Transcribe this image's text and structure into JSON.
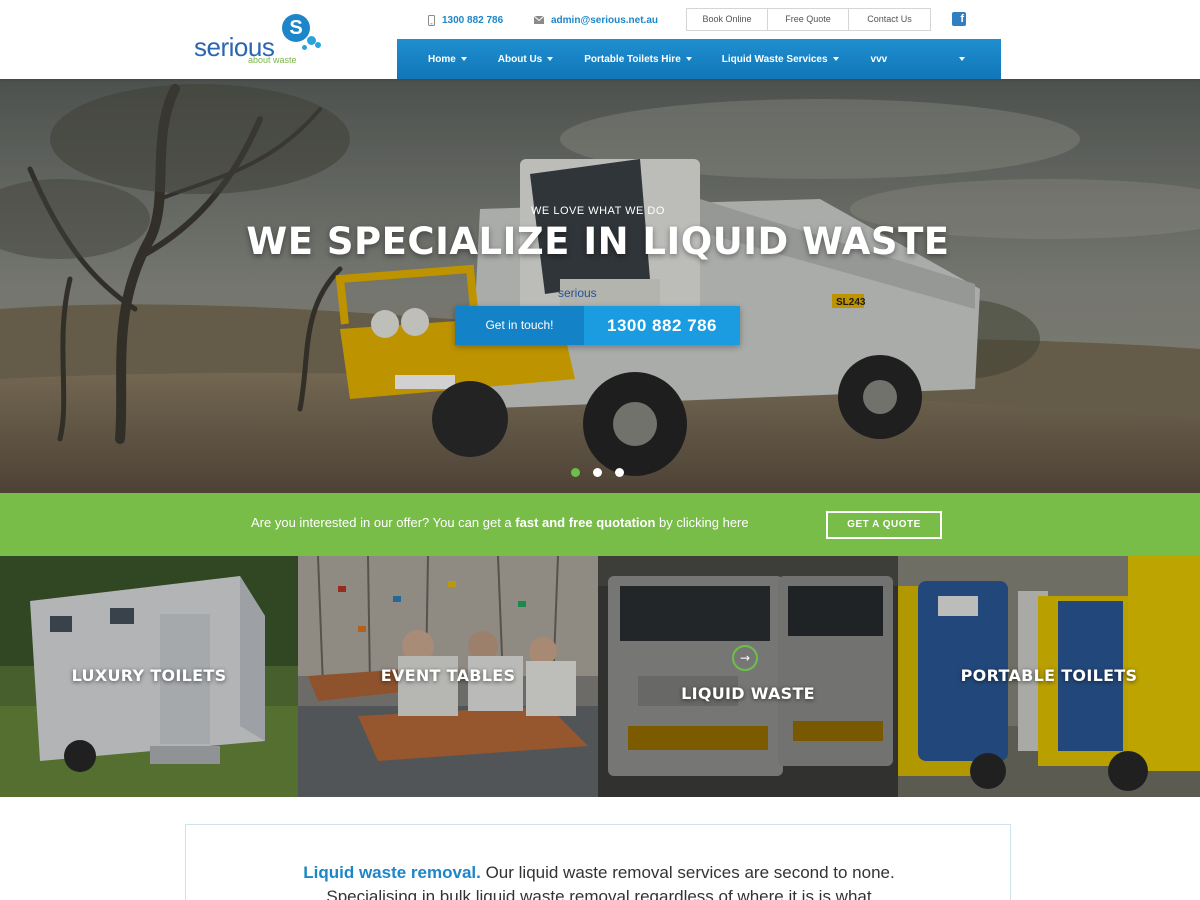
{
  "brand": {
    "name": "serious",
    "tagline": "about waste",
    "badge_letter": "S"
  },
  "header": {
    "phone": "1300 882 786",
    "email": "admin@serious.net.au",
    "top_links": [
      "Book Online",
      "Free Quote",
      "Contact Us"
    ],
    "social": {
      "icon": "facebook-icon"
    },
    "nav": [
      {
        "label": "Home",
        "has_dropdown": true
      },
      {
        "label": "About Us",
        "has_dropdown": true
      },
      {
        "label": "Portable Toilets Hire",
        "has_dropdown": true
      },
      {
        "label": "Liquid Waste Services",
        "has_dropdown": true
      },
      {
        "label": "vvv",
        "has_dropdown": false
      }
    ]
  },
  "hero": {
    "kicker": "WE LOVE WHAT WE DO",
    "title": "WE SPECIALIZE IN LIQUID WASTE",
    "cta_label": "Get in touch!",
    "cta_phone": "1300 882 786",
    "truck_brand_text": "serious",
    "plate_text": "SL243",
    "active_slide": 1,
    "slide_count": 3
  },
  "quote_bar": {
    "text_before": "Are you interested in our offer? You can get a ",
    "text_bold": "fast and free quotation",
    "text_after": " by clicking here",
    "button": "GET A QUOTE"
  },
  "tiles": [
    {
      "label": "LUXURY TOILETS"
    },
    {
      "label": "EVENT TABLES"
    },
    {
      "label": "LIQUID WASTE",
      "icon": "arrow-right-icon",
      "arrow": "→"
    },
    {
      "label": "PORTABLE TOILETS"
    }
  ],
  "intro": {
    "lead": "Liquid waste removal.",
    "text": " Our liquid waste removal services are second to none.",
    "line2": "Specialising in bulk liquid waste removal regardless of where it is is what"
  },
  "colors": {
    "brand_blue": "#1c86c8",
    "nav_blue": "#1276b7",
    "green": "#77bd48",
    "active_dot": "#6cc04a"
  }
}
